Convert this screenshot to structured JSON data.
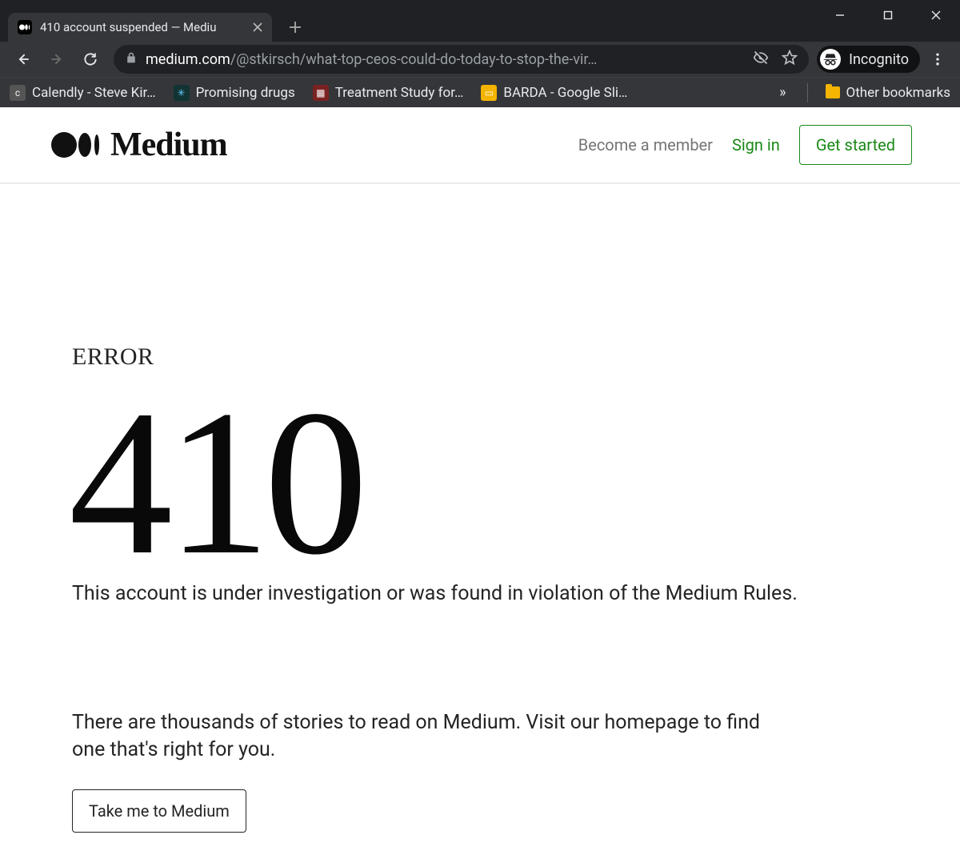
{
  "browser": {
    "tab_title": "410 account suspended — Mediu",
    "url_domain": "medium.com",
    "url_path": "/@stkirsch/what-top-ceos-could-do-today-to-stop-the-vir…",
    "incognito_label": "Incognito"
  },
  "bookmarks": {
    "items": [
      {
        "label": "Calendly - Steve Kir…",
        "icon_bg": "#555",
        "icon_text": "c"
      },
      {
        "label": "Promising drugs",
        "icon_bg": "#1a3b6e",
        "icon_text": "✳"
      },
      {
        "label": "Treatment Study for…",
        "icon_bg": "#8a2b2b",
        "icon_text": "▦"
      },
      {
        "label": "BARDA - Google Sli…",
        "icon_bg": "#f4b400",
        "icon_text": "▭"
      }
    ],
    "other_label": "Other bookmarks"
  },
  "navbar": {
    "become_member": "Become a member",
    "signin": "Sign in",
    "get_started": "Get started"
  },
  "error": {
    "label": "ERROR",
    "code": "410",
    "message": "This account is under investigation or was found in violation of the Medium Rules.",
    "subtext": "There are thousands of stories to read on Medium. Visit our homepage to find one that's right for you.",
    "cta": "Take me to Medium"
  }
}
